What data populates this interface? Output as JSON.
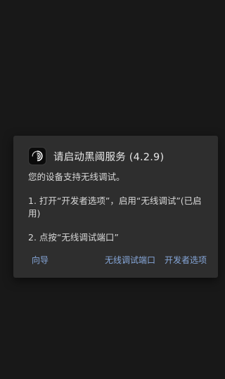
{
  "dialog": {
    "title": "请启动黑阈服务 (4.2.9)",
    "icon": "swirl-app-icon",
    "line1": "您的设备支持无线调试。",
    "step1": "1. 打开“开发者选项”，启用“无线调试”(已启用)",
    "step2": "2. 点按“无线调试端口”",
    "buttons": {
      "guide": "向导",
      "wireless_port": "无线调试端口",
      "developer_options": "开发者选项"
    }
  },
  "colors": {
    "background": "#181818",
    "dialog": "#2e2e2e",
    "accent": "#86a7d9"
  }
}
